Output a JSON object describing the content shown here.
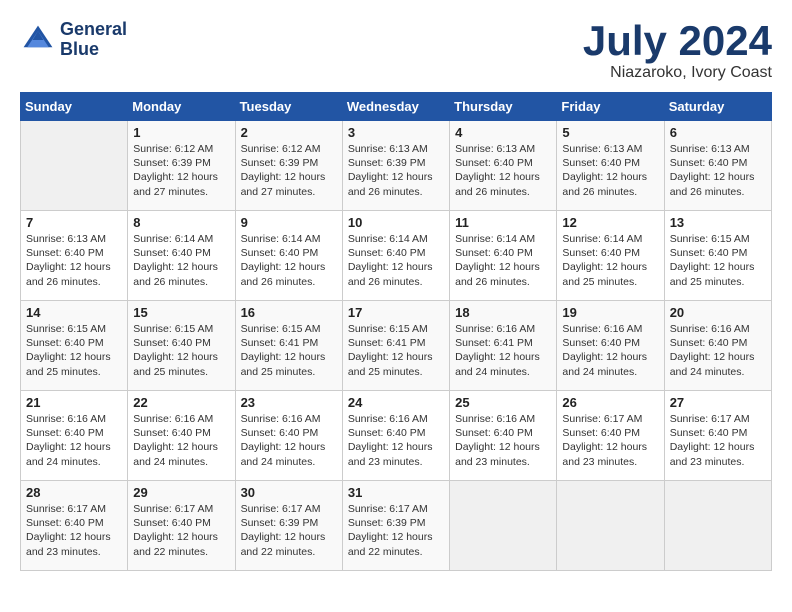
{
  "header": {
    "logo_line1": "General",
    "logo_line2": "Blue",
    "month": "July 2024",
    "location": "Niazaroko, Ivory Coast"
  },
  "days_of_week": [
    "Sunday",
    "Monday",
    "Tuesday",
    "Wednesday",
    "Thursday",
    "Friday",
    "Saturday"
  ],
  "weeks": [
    [
      {
        "day": "",
        "info": ""
      },
      {
        "day": "1",
        "info": "Sunrise: 6:12 AM\nSunset: 6:39 PM\nDaylight: 12 hours\nand 27 minutes."
      },
      {
        "day": "2",
        "info": "Sunrise: 6:12 AM\nSunset: 6:39 PM\nDaylight: 12 hours\nand 27 minutes."
      },
      {
        "day": "3",
        "info": "Sunrise: 6:13 AM\nSunset: 6:39 PM\nDaylight: 12 hours\nand 26 minutes."
      },
      {
        "day": "4",
        "info": "Sunrise: 6:13 AM\nSunset: 6:40 PM\nDaylight: 12 hours\nand 26 minutes."
      },
      {
        "day": "5",
        "info": "Sunrise: 6:13 AM\nSunset: 6:40 PM\nDaylight: 12 hours\nand 26 minutes."
      },
      {
        "day": "6",
        "info": "Sunrise: 6:13 AM\nSunset: 6:40 PM\nDaylight: 12 hours\nand 26 minutes."
      }
    ],
    [
      {
        "day": "7",
        "info": "Sunrise: 6:13 AM\nSunset: 6:40 PM\nDaylight: 12 hours\nand 26 minutes."
      },
      {
        "day": "8",
        "info": "Sunrise: 6:14 AM\nSunset: 6:40 PM\nDaylight: 12 hours\nand 26 minutes."
      },
      {
        "day": "9",
        "info": "Sunrise: 6:14 AM\nSunset: 6:40 PM\nDaylight: 12 hours\nand 26 minutes."
      },
      {
        "day": "10",
        "info": "Sunrise: 6:14 AM\nSunset: 6:40 PM\nDaylight: 12 hours\nand 26 minutes."
      },
      {
        "day": "11",
        "info": "Sunrise: 6:14 AM\nSunset: 6:40 PM\nDaylight: 12 hours\nand 26 minutes."
      },
      {
        "day": "12",
        "info": "Sunrise: 6:14 AM\nSunset: 6:40 PM\nDaylight: 12 hours\nand 25 minutes."
      },
      {
        "day": "13",
        "info": "Sunrise: 6:15 AM\nSunset: 6:40 PM\nDaylight: 12 hours\nand 25 minutes."
      }
    ],
    [
      {
        "day": "14",
        "info": "Sunrise: 6:15 AM\nSunset: 6:40 PM\nDaylight: 12 hours\nand 25 minutes."
      },
      {
        "day": "15",
        "info": "Sunrise: 6:15 AM\nSunset: 6:40 PM\nDaylight: 12 hours\nand 25 minutes."
      },
      {
        "day": "16",
        "info": "Sunrise: 6:15 AM\nSunset: 6:41 PM\nDaylight: 12 hours\nand 25 minutes."
      },
      {
        "day": "17",
        "info": "Sunrise: 6:15 AM\nSunset: 6:41 PM\nDaylight: 12 hours\nand 25 minutes."
      },
      {
        "day": "18",
        "info": "Sunrise: 6:16 AM\nSunset: 6:41 PM\nDaylight: 12 hours\nand 24 minutes."
      },
      {
        "day": "19",
        "info": "Sunrise: 6:16 AM\nSunset: 6:40 PM\nDaylight: 12 hours\nand 24 minutes."
      },
      {
        "day": "20",
        "info": "Sunrise: 6:16 AM\nSunset: 6:40 PM\nDaylight: 12 hours\nand 24 minutes."
      }
    ],
    [
      {
        "day": "21",
        "info": "Sunrise: 6:16 AM\nSunset: 6:40 PM\nDaylight: 12 hours\nand 24 minutes."
      },
      {
        "day": "22",
        "info": "Sunrise: 6:16 AM\nSunset: 6:40 PM\nDaylight: 12 hours\nand 24 minutes."
      },
      {
        "day": "23",
        "info": "Sunrise: 6:16 AM\nSunset: 6:40 PM\nDaylight: 12 hours\nand 24 minutes."
      },
      {
        "day": "24",
        "info": "Sunrise: 6:16 AM\nSunset: 6:40 PM\nDaylight: 12 hours\nand 23 minutes."
      },
      {
        "day": "25",
        "info": "Sunrise: 6:16 AM\nSunset: 6:40 PM\nDaylight: 12 hours\nand 23 minutes."
      },
      {
        "day": "26",
        "info": "Sunrise: 6:17 AM\nSunset: 6:40 PM\nDaylight: 12 hours\nand 23 minutes."
      },
      {
        "day": "27",
        "info": "Sunrise: 6:17 AM\nSunset: 6:40 PM\nDaylight: 12 hours\nand 23 minutes."
      }
    ],
    [
      {
        "day": "28",
        "info": "Sunrise: 6:17 AM\nSunset: 6:40 PM\nDaylight: 12 hours\nand 23 minutes."
      },
      {
        "day": "29",
        "info": "Sunrise: 6:17 AM\nSunset: 6:40 PM\nDaylight: 12 hours\nand 22 minutes."
      },
      {
        "day": "30",
        "info": "Sunrise: 6:17 AM\nSunset: 6:39 PM\nDaylight: 12 hours\nand 22 minutes."
      },
      {
        "day": "31",
        "info": "Sunrise: 6:17 AM\nSunset: 6:39 PM\nDaylight: 12 hours\nand 22 minutes."
      },
      {
        "day": "",
        "info": ""
      },
      {
        "day": "",
        "info": ""
      },
      {
        "day": "",
        "info": ""
      }
    ]
  ]
}
